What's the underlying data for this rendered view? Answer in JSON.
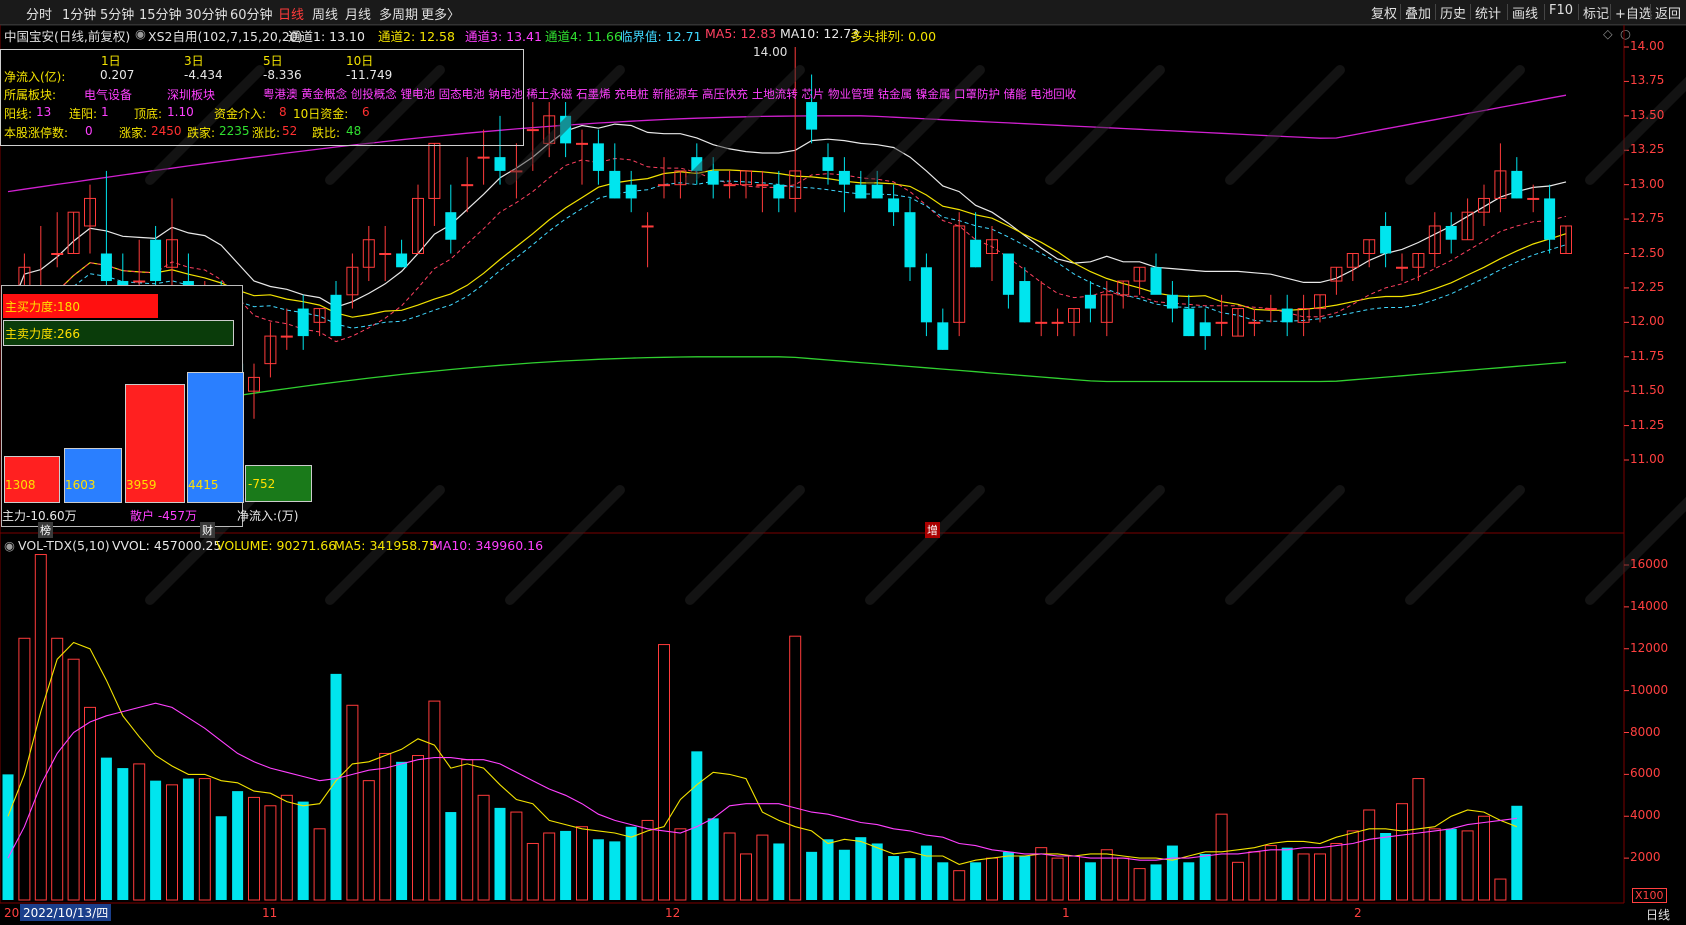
{
  "toolbar": {
    "periods": [
      "分时",
      "1分钟",
      "5分钟",
      "15分钟",
      "30分钟",
      "60分钟",
      "日线",
      "周线",
      "月线",
      "多周期",
      "更多〉"
    ],
    "active_period": "日线",
    "right": [
      "复权",
      "叠加",
      "历史",
      "统计",
      "画线",
      "F10",
      "标记",
      "+自选",
      "返回"
    ]
  },
  "header": {
    "stock": "中国宝安(日线,前复权)",
    "indicator": "XS2自用(102,7,15,20,20)",
    "items": [
      {
        "label": "通道1: 13.10",
        "color": "#e8e8e8"
      },
      {
        "label": "通道2: 12.58",
        "color": "#f2e200"
      },
      {
        "label": "通道3: 13.41",
        "color": "#ff40ff"
      },
      {
        "label": "通道4: 11.66",
        "color": "#30e030"
      },
      {
        "label": "临界值: 12.71",
        "color": "#40d8ff"
      },
      {
        "label": "MA5: 12.83",
        "color": "#ff4060"
      },
      {
        "label": "MA10: 12.73",
        "color": "#e8e8e8"
      },
      {
        "label": "多头排列: 0.00",
        "color": "#f2e200"
      }
    ]
  },
  "stats": {
    "periods": [
      "1日",
      "3日",
      "5日",
      "10日"
    ],
    "netflow_label": "净流入(亿):",
    "netflow": [
      "0.207",
      "-4.434",
      "-8.336",
      "-11.749"
    ],
    "sector_label": "所属板块:",
    "sectors": [
      "电气设备",
      "深圳板块"
    ],
    "concepts": "粤港澳 黄金概念 创投概念 锂电池 固态电池 钠电池 稀土永磁 石墨烯 充电桩 新能源车 高压快充 土地流转 芯片 物业管理 钴金属 镍金属 口罩防护 储能 电池回收",
    "row3": [
      {
        "k": "阳线:",
        "v": "13"
      },
      {
        "k": "连阳:",
        "v": "1"
      },
      {
        "k": "顶底:",
        "v": "1.10"
      },
      {
        "k": "资金介入:",
        "v": "8"
      },
      {
        "k": "10日资金:",
        "v": "6"
      }
    ],
    "row4": [
      {
        "k": "本股涨停数:",
        "v": "0"
      },
      {
        "k": "涨家:",
        "v": "2450"
      },
      {
        "k": "跌家:",
        "v": "2235"
      },
      {
        "k": "涨比:",
        "v": "52"
      },
      {
        "k": "跌比:",
        "v": "48"
      }
    ]
  },
  "flow": {
    "buy_label": "主买力度:180",
    "sell_label": "主卖力度:266",
    "bars": [
      {
        "value": "1308",
        "color": "#ff2020"
      },
      {
        "value": "1603",
        "color": "#2a7fff"
      },
      {
        "value": "3959",
        "color": "#ff2020"
      },
      {
        "value": "4415",
        "color": "#2a7fff"
      },
      {
        "value": "-752",
        "color": "#1a7a1a"
      }
    ],
    "bottom": [
      "主力-10.60万",
      "散户 -457万",
      "净流入:(万)"
    ],
    "tags": [
      "榜",
      "财",
      "增"
    ]
  },
  "price_axis": [
    "14.00",
    "13.75",
    "13.50",
    "13.25",
    "13.00",
    "12.75",
    "12.50",
    "12.25",
    "12.00",
    "11.75",
    "11.50",
    "11.25",
    "11.00"
  ],
  "high_mark": "14.00",
  "volume": {
    "title": "VOL-TDX(5,10)",
    "items": [
      {
        "label": "VVOL: 457000.25",
        "color": "#e8e8e8"
      },
      {
        "label": "VOLUME: 90271.66",
        "color": "#f2e200"
      },
      {
        "label": "MA5: 341958.75",
        "color": "#f2e200"
      },
      {
        "label": "MA10: 349960.16",
        "color": "#ff40ff"
      }
    ],
    "axis": [
      "16000",
      "14000",
      "12000",
      "10000",
      "8000",
      "6000",
      "4000",
      "2000"
    ],
    "unit": "X100"
  },
  "x_axis": {
    "date": "2022/10/13/四",
    "months": [
      "11",
      "12",
      "1",
      "2"
    ],
    "start_label": "20"
  },
  "bottom_right": "日线",
  "chart_data": {
    "type": "candlestick",
    "title": "中国宝安(日线,前复权)",
    "ylim": [
      10.8,
      14.1
    ],
    "candles": [
      [
        11.9,
        12.2,
        11.8,
        11.8
      ],
      [
        12.1,
        12.5,
        11.9,
        12.4
      ],
      [
        12.1,
        12.7,
        12.1,
        12.2
      ],
      [
        12.5,
        12.8,
        12.4,
        12.5
      ],
      [
        12.5,
        12.8,
        12.5,
        12.8
      ],
      [
        12.7,
        13.0,
        12.5,
        12.9
      ],
      [
        12.5,
        13.1,
        12.2,
        12.3
      ],
      [
        12.3,
        12.5,
        12.0,
        12.1
      ],
      [
        12.3,
        12.6,
        12.0,
        12.3
      ],
      [
        12.6,
        12.7,
        12.2,
        12.3
      ],
      [
        12.4,
        12.9,
        12.2,
        12.6
      ],
      [
        12.3,
        12.5,
        11.9,
        12.0
      ],
      [
        11.9,
        12.3,
        11.8,
        12.0
      ],
      [
        12.0,
        12.3,
        11.8,
        11.8
      ],
      [
        11.7,
        11.8,
        11.5,
        11.5
      ],
      [
        11.5,
        11.7,
        11.3,
        11.6
      ],
      [
        11.7,
        12.0,
        11.6,
        11.9
      ],
      [
        11.9,
        12.1,
        11.8,
        11.9
      ],
      [
        12.1,
        12.2,
        11.8,
        11.9
      ],
      [
        12.0,
        12.1,
        11.9,
        12.1
      ],
      [
        12.2,
        12.3,
        11.9,
        11.9
      ],
      [
        12.2,
        12.5,
        12.1,
        12.4
      ],
      [
        12.4,
        12.7,
        12.3,
        12.6
      ],
      [
        12.5,
        12.7,
        12.3,
        12.5
      ],
      [
        12.5,
        12.6,
        12.4,
        12.4
      ],
      [
        12.5,
        13.0,
        12.5,
        12.9
      ],
      [
        12.9,
        13.3,
        12.7,
        13.3
      ],
      [
        12.8,
        13.0,
        12.5,
        12.6
      ],
      [
        13.0,
        13.2,
        12.8,
        13.0
      ],
      [
        13.2,
        13.4,
        13.0,
        13.2
      ],
      [
        13.2,
        13.5,
        13.0,
        13.1
      ],
      [
        13.1,
        13.3,
        12.9,
        13.1
      ],
      [
        13.4,
        13.6,
        13.1,
        13.4
      ],
      [
        13.3,
        13.6,
        13.2,
        13.5
      ],
      [
        13.5,
        13.6,
        13.2,
        13.3
      ],
      [
        13.3,
        13.4,
        13.0,
        13.3
      ],
      [
        13.3,
        13.4,
        13.0,
        13.1
      ],
      [
        13.1,
        13.3,
        12.9,
        12.9
      ],
      [
        13.0,
        13.1,
        12.8,
        12.9
      ],
      [
        12.7,
        12.8,
        12.4,
        12.7
      ],
      [
        13.0,
        13.2,
        12.9,
        13.0
      ],
      [
        13.0,
        13.1,
        12.9,
        13.1
      ],
      [
        13.2,
        13.3,
        13.0,
        13.1
      ],
      [
        13.1,
        13.2,
        12.9,
        13.0
      ],
      [
        13.0,
        13.1,
        12.9,
        13.0
      ],
      [
        13.0,
        13.1,
        12.9,
        13.1
      ],
      [
        13.0,
        13.1,
        12.8,
        13.0
      ],
      [
        13.0,
        13.1,
        12.8,
        12.9
      ],
      [
        12.9,
        14.0,
        12.8,
        13.1
      ],
      [
        13.6,
        13.8,
        13.3,
        13.4
      ],
      [
        13.2,
        13.3,
        13.0,
        13.1
      ],
      [
        13.1,
        13.2,
        12.8,
        13.0
      ],
      [
        13.0,
        13.1,
        12.9,
        12.9
      ],
      [
        13.0,
        13.1,
        12.9,
        12.9
      ],
      [
        12.9,
        13.0,
        12.7,
        12.8
      ],
      [
        12.8,
        12.9,
        12.3,
        12.4
      ],
      [
        12.4,
        12.5,
        11.9,
        12.0
      ],
      [
        12.0,
        12.1,
        11.8,
        11.8
      ],
      [
        12.0,
        12.8,
        11.9,
        12.7
      ],
      [
        12.6,
        12.8,
        12.4,
        12.4
      ],
      [
        12.5,
        12.7,
        12.3,
        12.6
      ],
      [
        12.5,
        12.5,
        12.1,
        12.2
      ],
      [
        12.3,
        12.4,
        12.0,
        12.0
      ],
      [
        12.0,
        12.3,
        11.9,
        12.0
      ],
      [
        12.0,
        12.1,
        11.9,
        12.0
      ],
      [
        12.0,
        12.1,
        11.9,
        12.1
      ],
      [
        12.2,
        12.3,
        12.0,
        12.1
      ],
      [
        12.0,
        12.3,
        11.9,
        12.2
      ],
      [
        12.2,
        12.3,
        12.1,
        12.3
      ],
      [
        12.3,
        12.4,
        12.2,
        12.4
      ],
      [
        12.4,
        12.5,
        12.3,
        12.2
      ],
      [
        12.2,
        12.3,
        12.0,
        12.1
      ],
      [
        12.1,
        12.2,
        11.9,
        11.9
      ],
      [
        12.0,
        12.1,
        11.8,
        11.9
      ],
      [
        12.0,
        12.2,
        11.9,
        12.0
      ],
      [
        11.9,
        12.1,
        11.9,
        12.1
      ],
      [
        12.0,
        12.1,
        11.9,
        12.0
      ],
      [
        12.1,
        12.2,
        12.0,
        12.1
      ],
      [
        12.1,
        12.2,
        11.9,
        12.0
      ],
      [
        12.0,
        12.2,
        11.9,
        12.1
      ],
      [
        12.1,
        12.2,
        12.0,
        12.2
      ],
      [
        12.3,
        12.4,
        12.2,
        12.4
      ],
      [
        12.4,
        12.5,
        12.3,
        12.5
      ],
      [
        12.5,
        12.6,
        12.4,
        12.6
      ],
      [
        12.7,
        12.8,
        12.4,
        12.5
      ],
      [
        12.4,
        12.5,
        12.3,
        12.4
      ],
      [
        12.4,
        12.5,
        12.3,
        12.5
      ],
      [
        12.5,
        12.8,
        12.4,
        12.7
      ],
      [
        12.7,
        12.8,
        12.5,
        12.6
      ],
      [
        12.6,
        12.9,
        12.6,
        12.8
      ],
      [
        12.8,
        13.0,
        12.7,
        12.9
      ],
      [
        12.9,
        13.3,
        12.8,
        13.1
      ],
      [
        13.1,
        13.2,
        12.9,
        12.9
      ],
      [
        12.9,
        13.0,
        12.8,
        12.9
      ],
      [
        12.9,
        13.0,
        12.5,
        12.6
      ],
      [
        12.5,
        12.7,
        12.5,
        12.7
      ]
    ],
    "volume": [
      6000,
      12500,
      16500,
      12500,
      11500,
      9200,
      6800,
      6300,
      6500,
      5700,
      5500,
      5800,
      5800,
      4000,
      5200,
      4900,
      4500,
      5000,
      4700,
      3400,
      10800,
      9300,
      5700,
      7000,
      6600,
      6900,
      9500,
      4200,
      6700,
      5000,
      4400,
      4200,
      2700,
      3200,
      3300,
      3500,
      2900,
      2800,
      3500,
      3800,
      12200,
      3400,
      7100,
      3900,
      3200,
      2200,
      3100,
      2700,
      12600,
      2300,
      2900,
      2400,
      3000,
      2700,
      2100,
      2000,
      2600,
      1800,
      1400,
      1800,
      2000,
      2300,
      2100,
      2500,
      2000,
      2100,
      1800,
      2400,
      2000,
      1500,
      1700,
      2600,
      1800,
      2200,
      4100,
      1800,
      2300,
      2600,
      2500,
      2200,
      2200,
      2700,
      3300,
      4300,
      3200,
      4600,
      5800,
      3400,
      3400,
      3300,
      4000,
      1000,
      4500
    ],
    "ma5": [
      4000,
      6000,
      9000,
      11500,
      12300,
      12000,
      10500,
      8800,
      7800,
      6900,
      6400,
      6000,
      6000,
      5700,
      5600,
      5200,
      5100,
      4700,
      4500,
      4600,
      5700,
      6500,
      6600,
      6900,
      7200,
      7700,
      7400,
      6300,
      6500,
      6300,
      5500,
      4800,
      4600,
      3800,
      3600,
      3400,
      3300,
      3200,
      3000,
      3300,
      3500,
      4800,
      5500,
      6100,
      6000,
      5800,
      4200,
      3800,
      3500,
      3300,
      2700,
      2900,
      2800,
      2500,
      2200,
      2300,
      2100,
      2100,
      1700,
      1900,
      2000,
      2100,
      2100,
      2200,
      2200,
      2100,
      2200,
      2200,
      2100,
      2000,
      2000,
      1900,
      2100,
      2300,
      2300,
      2400,
      2500,
      2700,
      2800,
      2800,
      2700,
      3000,
      3200,
      3400,
      3400,
      3300,
      3400,
      3500,
      4000,
      4300,
      4200,
      3800,
      3500
    ],
    "ma10": [
      2000,
      3500,
      5500,
      7000,
      8000,
      8500,
      8800,
      9000,
      9200,
      9400,
      9200,
      8700,
      8200,
      7600,
      7000,
      6600,
      6300,
      6100,
      5900,
      5700,
      5800,
      6000,
      6200,
      6300,
      6500,
      6700,
      6800,
      6800,
      6700,
      6700,
      6500,
      6100,
      5700,
      5300,
      5000,
      4600,
      4100,
      3800,
      3600,
      3400,
      3300,
      3200,
      3500,
      3900,
      4500,
      4600,
      4600,
      4600,
      4400,
      4200,
      4100,
      3900,
      3700,
      3600,
      3400,
      3300,
      3100,
      3000,
      2700,
      2600,
      2400,
      2300,
      2200,
      2200,
      2100,
      2100,
      2000,
      2000,
      2000,
      1900,
      1900,
      2000,
      2000,
      2100,
      2200,
      2200,
      2300,
      2400,
      2400,
      2500,
      2500,
      2600,
      2700,
      2900,
      3000,
      3100,
      3200,
      3300,
      3400,
      3600,
      3700,
      3800,
      3900
    ]
  }
}
